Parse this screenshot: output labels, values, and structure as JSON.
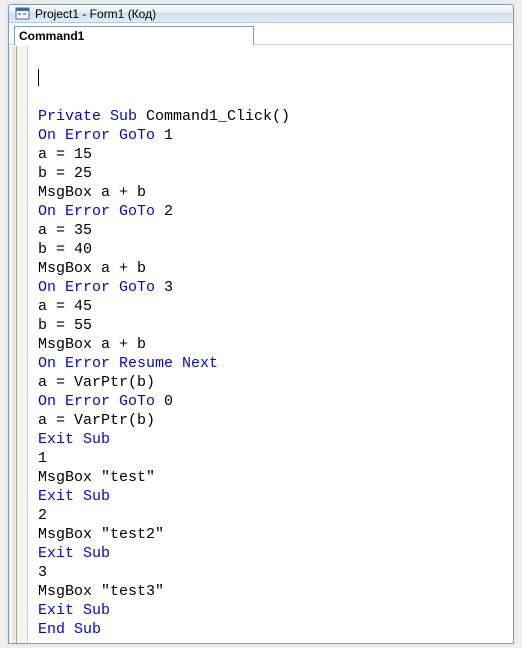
{
  "window": {
    "title": "Project1 - Form1 (Код)"
  },
  "combo": {
    "object": "Command1"
  },
  "code": {
    "lines": [
      [
        {
          "t": "Private Sub",
          "k": true
        },
        {
          "t": " Command1_Click()",
          "k": false
        }
      ],
      [
        {
          "t": "On Error GoTo",
          "k": true
        },
        {
          "t": " 1",
          "k": false
        }
      ],
      [
        {
          "t": "a = 15",
          "k": false
        }
      ],
      [
        {
          "t": "b = 25",
          "k": false
        }
      ],
      [
        {
          "t": "MsgBox a + b",
          "k": false
        }
      ],
      [
        {
          "t": "On Error GoTo",
          "k": true
        },
        {
          "t": " 2",
          "k": false
        }
      ],
      [
        {
          "t": "a = 35",
          "k": false
        }
      ],
      [
        {
          "t": "b = 40",
          "k": false
        }
      ],
      [
        {
          "t": "MsgBox a + b",
          "k": false
        }
      ],
      [
        {
          "t": "On Error GoTo",
          "k": true
        },
        {
          "t": " 3",
          "k": false
        }
      ],
      [
        {
          "t": "a = 45",
          "k": false
        }
      ],
      [
        {
          "t": "b = 55",
          "k": false
        }
      ],
      [
        {
          "t": "MsgBox a + b",
          "k": false
        }
      ],
      [
        {
          "t": "On Error Resume Next",
          "k": true
        }
      ],
      [
        {
          "t": "a = VarPtr(b)",
          "k": false
        }
      ],
      [
        {
          "t": "On Error GoTo",
          "k": true
        },
        {
          "t": " 0",
          "k": false
        }
      ],
      [
        {
          "t": "a = VarPtr(b)",
          "k": false
        }
      ],
      [
        {
          "t": "Exit Sub",
          "k": true
        }
      ],
      [
        {
          "t": "1",
          "k": false
        }
      ],
      [
        {
          "t": "MsgBox \"test\"",
          "k": false
        }
      ],
      [
        {
          "t": "Exit Sub",
          "k": true
        }
      ],
      [
        {
          "t": "2",
          "k": false
        }
      ],
      [
        {
          "t": "MsgBox \"test2\"",
          "k": false
        }
      ],
      [
        {
          "t": "Exit Sub",
          "k": true
        }
      ],
      [
        {
          "t": "3",
          "k": false
        }
      ],
      [
        {
          "t": "MsgBox \"test3\"",
          "k": false
        }
      ],
      [
        {
          "t": "Exit Sub",
          "k": true
        }
      ],
      [
        {
          "t": "End Sub",
          "k": true
        }
      ]
    ]
  }
}
